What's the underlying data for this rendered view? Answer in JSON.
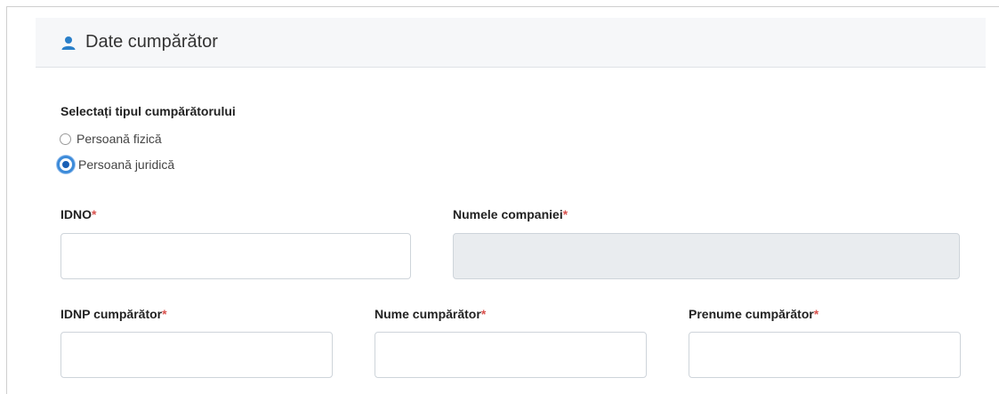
{
  "header": {
    "title": "Date cumpărător",
    "icon": "user-icon"
  },
  "buyer_type": {
    "label": "Selectați tipul cumpărătorului",
    "options": [
      {
        "label": "Persoană fizică",
        "checked": false
      },
      {
        "label": "Persoană juridică",
        "checked": true
      }
    ]
  },
  "fields": {
    "idno": {
      "label": "IDNO",
      "required_mark": "*",
      "value": ""
    },
    "company_name": {
      "label": "Numele companiei",
      "required_mark": "*",
      "value": "",
      "disabled": true
    },
    "idnp": {
      "label": "IDNP cumpărător",
      "required_mark": "*",
      "value": ""
    },
    "last_name": {
      "label": "Nume cumpărător",
      "required_mark": "*",
      "value": ""
    },
    "first_name": {
      "label": "Prenume cumpărător",
      "required_mark": "*",
      "value": ""
    }
  },
  "colors": {
    "accent": "#3d8bd9",
    "required": "#d9534f",
    "header_bg": "#f6f7f9",
    "disabled_bg": "#e9ecef"
  }
}
